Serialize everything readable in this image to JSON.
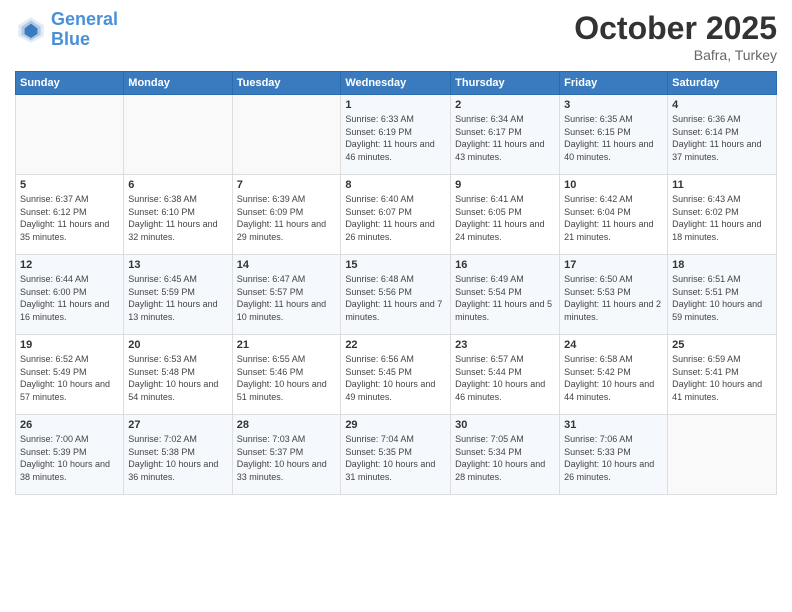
{
  "header": {
    "logo_line1": "General",
    "logo_line2": "Blue",
    "month": "October 2025",
    "location": "Bafra, Turkey"
  },
  "weekdays": [
    "Sunday",
    "Monday",
    "Tuesday",
    "Wednesday",
    "Thursday",
    "Friday",
    "Saturday"
  ],
  "weeks": [
    [
      {
        "day": "",
        "info": ""
      },
      {
        "day": "",
        "info": ""
      },
      {
        "day": "",
        "info": ""
      },
      {
        "day": "1",
        "info": "Sunrise: 6:33 AM\nSunset: 6:19 PM\nDaylight: 11 hours and 46 minutes."
      },
      {
        "day": "2",
        "info": "Sunrise: 6:34 AM\nSunset: 6:17 PM\nDaylight: 11 hours and 43 minutes."
      },
      {
        "day": "3",
        "info": "Sunrise: 6:35 AM\nSunset: 6:15 PM\nDaylight: 11 hours and 40 minutes."
      },
      {
        "day": "4",
        "info": "Sunrise: 6:36 AM\nSunset: 6:14 PM\nDaylight: 11 hours and 37 minutes."
      }
    ],
    [
      {
        "day": "5",
        "info": "Sunrise: 6:37 AM\nSunset: 6:12 PM\nDaylight: 11 hours and 35 minutes."
      },
      {
        "day": "6",
        "info": "Sunrise: 6:38 AM\nSunset: 6:10 PM\nDaylight: 11 hours and 32 minutes."
      },
      {
        "day": "7",
        "info": "Sunrise: 6:39 AM\nSunset: 6:09 PM\nDaylight: 11 hours and 29 minutes."
      },
      {
        "day": "8",
        "info": "Sunrise: 6:40 AM\nSunset: 6:07 PM\nDaylight: 11 hours and 26 minutes."
      },
      {
        "day": "9",
        "info": "Sunrise: 6:41 AM\nSunset: 6:05 PM\nDaylight: 11 hours and 24 minutes."
      },
      {
        "day": "10",
        "info": "Sunrise: 6:42 AM\nSunset: 6:04 PM\nDaylight: 11 hours and 21 minutes."
      },
      {
        "day": "11",
        "info": "Sunrise: 6:43 AM\nSunset: 6:02 PM\nDaylight: 11 hours and 18 minutes."
      }
    ],
    [
      {
        "day": "12",
        "info": "Sunrise: 6:44 AM\nSunset: 6:00 PM\nDaylight: 11 hours and 16 minutes."
      },
      {
        "day": "13",
        "info": "Sunrise: 6:45 AM\nSunset: 5:59 PM\nDaylight: 11 hours and 13 minutes."
      },
      {
        "day": "14",
        "info": "Sunrise: 6:47 AM\nSunset: 5:57 PM\nDaylight: 11 hours and 10 minutes."
      },
      {
        "day": "15",
        "info": "Sunrise: 6:48 AM\nSunset: 5:56 PM\nDaylight: 11 hours and 7 minutes."
      },
      {
        "day": "16",
        "info": "Sunrise: 6:49 AM\nSunset: 5:54 PM\nDaylight: 11 hours and 5 minutes."
      },
      {
        "day": "17",
        "info": "Sunrise: 6:50 AM\nSunset: 5:53 PM\nDaylight: 11 hours and 2 minutes."
      },
      {
        "day": "18",
        "info": "Sunrise: 6:51 AM\nSunset: 5:51 PM\nDaylight: 10 hours and 59 minutes."
      }
    ],
    [
      {
        "day": "19",
        "info": "Sunrise: 6:52 AM\nSunset: 5:49 PM\nDaylight: 10 hours and 57 minutes."
      },
      {
        "day": "20",
        "info": "Sunrise: 6:53 AM\nSunset: 5:48 PM\nDaylight: 10 hours and 54 minutes."
      },
      {
        "day": "21",
        "info": "Sunrise: 6:55 AM\nSunset: 5:46 PM\nDaylight: 10 hours and 51 minutes."
      },
      {
        "day": "22",
        "info": "Sunrise: 6:56 AM\nSunset: 5:45 PM\nDaylight: 10 hours and 49 minutes."
      },
      {
        "day": "23",
        "info": "Sunrise: 6:57 AM\nSunset: 5:44 PM\nDaylight: 10 hours and 46 minutes."
      },
      {
        "day": "24",
        "info": "Sunrise: 6:58 AM\nSunset: 5:42 PM\nDaylight: 10 hours and 44 minutes."
      },
      {
        "day": "25",
        "info": "Sunrise: 6:59 AM\nSunset: 5:41 PM\nDaylight: 10 hours and 41 minutes."
      }
    ],
    [
      {
        "day": "26",
        "info": "Sunrise: 7:00 AM\nSunset: 5:39 PM\nDaylight: 10 hours and 38 minutes."
      },
      {
        "day": "27",
        "info": "Sunrise: 7:02 AM\nSunset: 5:38 PM\nDaylight: 10 hours and 36 minutes."
      },
      {
        "day": "28",
        "info": "Sunrise: 7:03 AM\nSunset: 5:37 PM\nDaylight: 10 hours and 33 minutes."
      },
      {
        "day": "29",
        "info": "Sunrise: 7:04 AM\nSunset: 5:35 PM\nDaylight: 10 hours and 31 minutes."
      },
      {
        "day": "30",
        "info": "Sunrise: 7:05 AM\nSunset: 5:34 PM\nDaylight: 10 hours and 28 minutes."
      },
      {
        "day": "31",
        "info": "Sunrise: 7:06 AM\nSunset: 5:33 PM\nDaylight: 10 hours and 26 minutes."
      },
      {
        "day": "",
        "info": ""
      }
    ]
  ]
}
